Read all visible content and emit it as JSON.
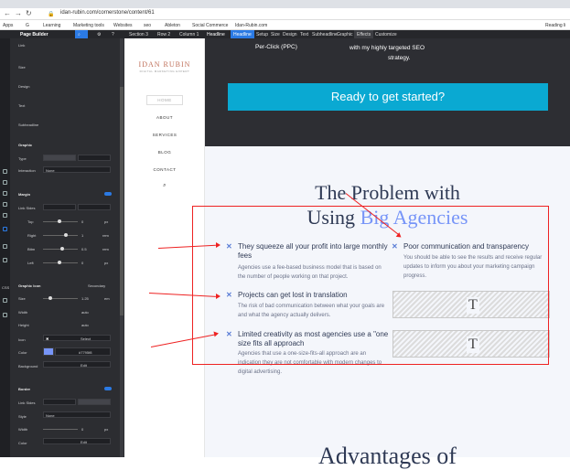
{
  "browser": {
    "url": "idan-rubin.com/cornerstone/content/61",
    "bookmarks": [
      "Apps",
      "G",
      "Learning",
      "Marketing tools",
      "Websites",
      "seo",
      "Ableton",
      "Social Commerce",
      "Idan-Rubin.com",
      "Reading li"
    ]
  },
  "builder": {
    "title": "Page Builder",
    "breadcrumbs": [
      "Section 3",
      "Row 2",
      "Column 1",
      "Headline"
    ],
    "tabs": [
      "Headline",
      "Setup",
      "Size",
      "Design",
      "Text",
      "Subheadline",
      "Graphic",
      "Effects",
      "Customize"
    ]
  },
  "panel": {
    "sections": [
      "Link",
      "Size",
      "Design",
      "Text",
      "Subheadline",
      "Graphic"
    ],
    "type_label": "Type",
    "interaction_label": "Interaction",
    "interaction_value": "None",
    "margin_label": "Margin",
    "link_sides": "Link Sides",
    "margin_rows": [
      {
        "label": "Top",
        "value": "0",
        "unit": "px"
      },
      {
        "label": "Right",
        "value": "1",
        "unit": "rem"
      },
      {
        "label": "Bttm",
        "value": "0.5",
        "unit": "rem"
      },
      {
        "label": "Left",
        "value": "0",
        "unit": "px"
      }
    ],
    "graphic_icon_label": "Graphic Icon",
    "secondary_label": "Secondary",
    "size_label": "Size",
    "size_value": "1.25",
    "size_unit": "em",
    "width_label": "Width",
    "width_value": "auto",
    "height_label": "Height",
    "height_value": "auto",
    "icon_label": "Icon",
    "icon_value": "Select",
    "color_label": "Color",
    "color_value": "#7795f8",
    "color_swatch": "#7795f8",
    "background_label": "Background",
    "background_value": "Edit",
    "border_label": "Border",
    "border_style_label": "Style",
    "border_style_value": "None",
    "border_width_label": "Width",
    "border_width_value": "0",
    "border_width_unit": "px",
    "border_color_label": "Color",
    "border_color_value": "Edit"
  },
  "site": {
    "logo_name": "IDAN RUBIN",
    "logo_tagline": "DIGITAL MARKETING EXPERT",
    "nav": [
      "HOME",
      "ABOUT",
      "SERVICES",
      "BLOG",
      "CONTACT"
    ],
    "hero_left": "Per-Click (PPC)",
    "hero_right_1": "with my highly targeted SEO",
    "hero_right_2": "strategy.",
    "cta": "Ready to get started?",
    "heading_line1": "The Problem with",
    "heading_line2_plain": "Using ",
    "heading_line2_accent": "Big Agencies",
    "accent_color": "#7795f8",
    "left_points": [
      {
        "title": "They squeeze all your profit into large monthly fees",
        "desc": "Agencies use a fee-based business model that is based on the number of people working on that project."
      },
      {
        "title": "Projects can get lost in translation",
        "desc": "The risk of bad communication between what your goals are and what the agency actually delivers."
      },
      {
        "title": "Limited creativity as most agencies use a \"one size fits all approach",
        "desc": "Agencies that use a one-size-fits-all approach are an indication they are not comfortable with modern changes to digital advertising."
      }
    ],
    "right_point": {
      "title": "Poor communication and transparency",
      "desc": "You should be able to see the results and receive regular updates to inform you about your marketing campaign progress."
    },
    "placeholder_glyph": "T",
    "bottom_heading": "Advantages of"
  }
}
